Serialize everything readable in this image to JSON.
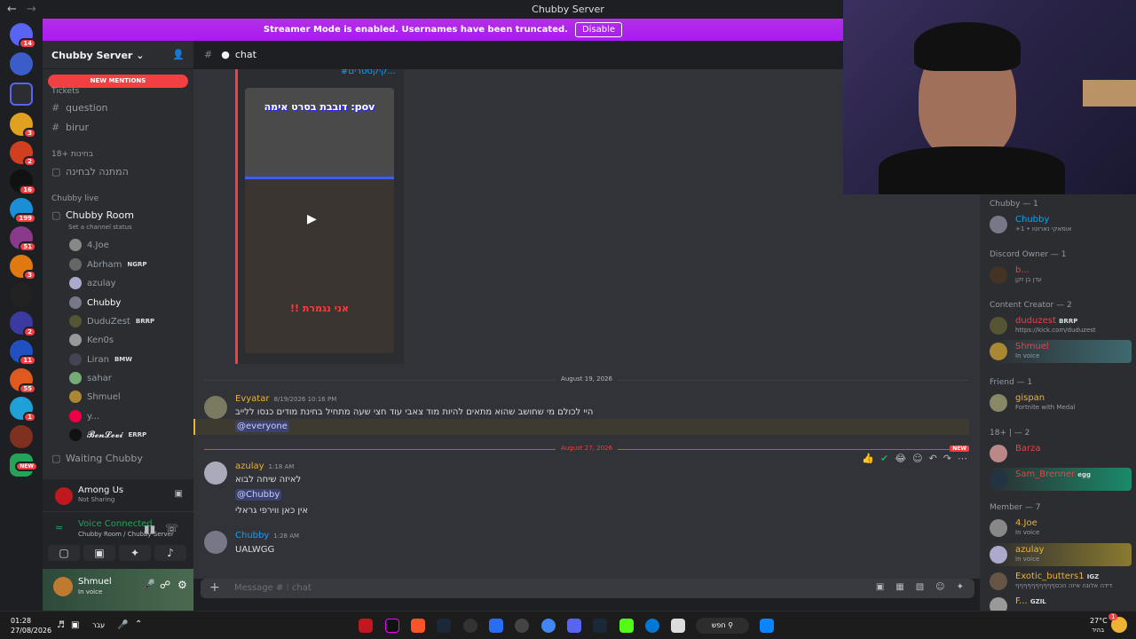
{
  "window": {
    "title": "Chubby Server"
  },
  "banner": {
    "text": "Streamer Mode is enabled. Usernames have been truncated.",
    "disable": "Disable"
  },
  "guilds": [
    {
      "badge": "14"
    },
    {
      "badge": ""
    },
    {
      "badge": ""
    },
    {
      "badge": "3"
    },
    {
      "badge": "2"
    },
    {
      "badge": "16"
    },
    {
      "badge": "199"
    },
    {
      "badge": "51"
    },
    {
      "badge": "3"
    },
    {
      "badge": ""
    },
    {
      "badge": "2"
    },
    {
      "badge": "11"
    },
    {
      "badge": "55"
    },
    {
      "badge": "1"
    },
    {
      "badge": ""
    },
    {
      "badge": "NEW"
    }
  ],
  "server": {
    "name": "Chubby Server",
    "new_mentions": "NEW MENTIONS"
  },
  "channels": {
    "cat_tickets": "Tickets",
    "question": "question",
    "birur": "birur",
    "cat_18": "18+ בחינות",
    "exam_wait": "המתנה לבחינה",
    "cat_live": "Chubby live",
    "room": "Chubby Room",
    "room_status": "Set a channel status",
    "waiting": "Waiting Chubby"
  },
  "voice_users": [
    {
      "name": "4.Joe",
      "tag": ""
    },
    {
      "name": "Abrham",
      "tag": "NGRP"
    },
    {
      "name": "azulay",
      "tag": ""
    },
    {
      "name": "Chubby",
      "tag": ""
    },
    {
      "name": "DuduZest",
      "tag": "BRRP"
    },
    {
      "name": "Ken0s",
      "tag": ""
    },
    {
      "name": "Liran",
      "tag": "BMW"
    },
    {
      "name": "sahar",
      "tag": ""
    },
    {
      "name": "Shmuel",
      "tag": ""
    },
    {
      "name": "y...",
      "tag": ""
    },
    {
      "name": "𝓑𝓮𝓷𝓛𝓮𝓿𝓲",
      "tag": "ERRP"
    }
  ],
  "activity": {
    "title": "Among Us",
    "sub": "Not Sharing"
  },
  "voice": {
    "status": "Voice Connected",
    "where": "Chubby Room / Chubby Server"
  },
  "user": {
    "name": "Shmuel",
    "status": "In voice"
  },
  "topbar": {
    "channel": "chat"
  },
  "chat": {
    "link_text": "#קיקסטרים...",
    "img_caption_top": "דובבת בסרט אימה :pov",
    "img_caption_bottom": "!! אני נגמרת",
    "date1": "August 19, 2026",
    "m1": {
      "name": "Evyatar",
      "time": "8/19/2026 10:16 PM",
      "text": "היי לכולם מי שחושב שהוא מתאים להיות מוד צאבי עוד חצי שעה מתחיל בחינת מודים כנסו ללייב",
      "mention": "@everyone"
    },
    "date2": "August 27, 2026",
    "new": "NEW",
    "m2": {
      "name": "azulay",
      "time": "1:18 AM",
      "text1": "לאיזה שיחה לבוא",
      "mention": "@Chubby",
      "text2": "אין כאן ווירפי גראלי"
    },
    "m3": {
      "name": "Chubby",
      "time": "1:28 AM",
      "text": "UALWGG"
    },
    "composer_placeholder": "Message #  ⁝ chat"
  },
  "members": {
    "g1": "Chubby — 1",
    "u1": {
      "name": "Chubby",
      "status": "+1 • אומאקי נארוטו"
    },
    "g2": "Discord Owner — 1",
    "u2": {
      "name": "b...",
      "status": "עדן בן זקן"
    },
    "g3": "Content Creator — 2",
    "u3": {
      "name": "duduzest",
      "tag": "BRRP",
      "status": "https://kick.com/duduzest"
    },
    "u4": {
      "name": "Shmuel",
      "status": "In voice"
    },
    "g4": "Friend — 1",
    "u5": {
      "name": "gispan",
      "status": "Fortnite with Medal"
    },
    "g5": "18+ | — 2",
    "u6": {
      "name": "Barza",
      "status": ""
    },
    "u7": {
      "name": "Sam_Brenner",
      "tag": "egg",
      "status": ""
    },
    "g6": "Member — 7",
    "u8": {
      "name": "4.Joe",
      "status": "In voice"
    },
    "u9": {
      "name": "azulay",
      "status": "In voice"
    },
    "u10": {
      "name": "Exotic_butters1",
      "tag": "IGZ",
      "status": "דידה אלונה איזה הכסףףףףףףףףףף"
    },
    "u11": {
      "name": "F...",
      "tag": "GZIL",
      "status": ""
    }
  },
  "taskbar": {
    "time": "01:28",
    "date": "27/08/2026",
    "lang": "עבר",
    "search": "חפש",
    "weather": "27°C",
    "weather_sub": "בהיר",
    "notif": "1"
  },
  "colors": {
    "accent": "#5865f2",
    "banner": "#a81bf0",
    "mention_red": "#f23f43",
    "green": "#23a559"
  }
}
